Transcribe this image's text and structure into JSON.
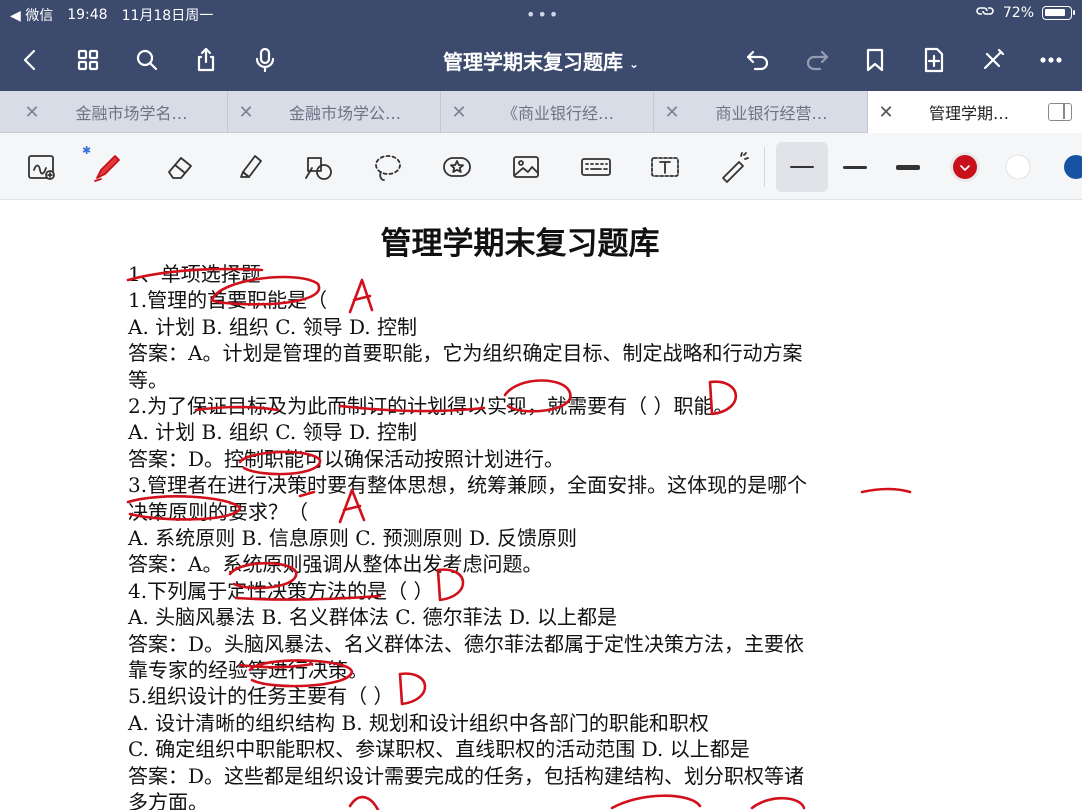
{
  "status_bar": {
    "back_app": "◀ 微信",
    "time": "19:48",
    "date": "11月18日周一",
    "battery": "72%"
  },
  "toolbar": {
    "title": "管理学期末复习题库",
    "title_caret": "⌄"
  },
  "tabs": [
    {
      "label": "金融市场学名…",
      "active": false
    },
    {
      "label": "金融市场学公…",
      "active": false
    },
    {
      "label": "《商业银行经…",
      "active": false
    },
    {
      "label": "商业银行经营…",
      "active": false
    },
    {
      "label": "管理学期…",
      "active": true
    }
  ],
  "annotation_tools": {
    "bluetooth_mark": "✱",
    "pen_color": "#c8101c"
  },
  "document": {
    "title": "管理学期末复习题库",
    "lines": [
      "1、单项选择题",
      "1.管理的首要职能是（",
      "A. 计划  B. 组织  C. 领导  D. 控制",
      "答案：A。计划是管理的首要职能，它为组织确定目标、制定战略和行动方案",
      "等。",
      "2.为了保证目标及为此而制订的计划得以实现，就需要有（ ）职能。",
      "A. 计划  B. 组织  C. 领导  D. 控制",
      "答案：D。控制职能可以确保活动按照计划进行。",
      "3.管理者在进行决策时要有整体思想，统筹兼顾，全面安排。这体现的是哪个",
      "决策原则的要求？（",
      "A. 系统原则  B. 信息原则  C. 预测原则  D. 反馈原则",
      "答案：A。系统原则强调从整体出发考虑问题。",
      "4.下列属于定性决策方法的是（ ）",
      "A. 头脑风暴法  B. 名义群体法  C. 德尔菲法  D. 以上都是",
      "答案：D。头脑风暴法、名义群体法、德尔菲法都属于定性决策方法，主要依",
      "靠专家的经验等进行决策。",
      "5.组织设计的任务主要有（ ）",
      "A. 设计清晰的组织结构  B. 规划和设计组织中各部门的职能和职权",
      "C. 确定组织中职能职权、参谋职权、直线职权的活动范围  D. 以上都是",
      "答案：D。这些都是组织设计需要完成的任务，包括构建结构、划分职权等诸",
      "多方面。"
    ]
  }
}
